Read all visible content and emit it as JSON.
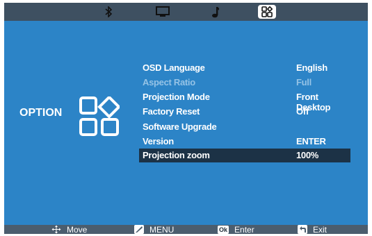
{
  "tabs": [
    {
      "icon": "bluetooth-icon",
      "active": false
    },
    {
      "icon": "monitor-icon",
      "active": false
    },
    {
      "icon": "music-note-icon",
      "active": false
    },
    {
      "icon": "option-grid-icon",
      "active": true
    }
  ],
  "category": {
    "label": "OPTION",
    "icon": "option-shapes-icon"
  },
  "menu": {
    "items": [
      {
        "label": "OSD Language",
        "value": "English",
        "disabled": false,
        "selected": false
      },
      {
        "label": "Aspect Ratio",
        "value": "Full",
        "disabled": true,
        "selected": false
      },
      {
        "label": "Projection Mode",
        "value": "Front Desktop",
        "disabled": false,
        "selected": false
      },
      {
        "label": "Factory Reset",
        "value": "Off",
        "disabled": false,
        "selected": false
      },
      {
        "label": "Software Upgrade",
        "value": "",
        "disabled": false,
        "selected": false
      },
      {
        "label": "Version",
        "value": "ENTER",
        "disabled": false,
        "selected": false
      },
      {
        "label": "Projection zoom",
        "value": "100%",
        "disabled": false,
        "selected": true
      }
    ]
  },
  "footer": {
    "move": "Move",
    "menu": "MENU",
    "ok_badge": "Ok",
    "enter": "Enter",
    "exit": "Exit"
  },
  "colors": {
    "panel": "#2c84c7",
    "bar": "#4b5d6e",
    "selected_row": "#1c3246",
    "disabled_text": "#95c3e6"
  }
}
